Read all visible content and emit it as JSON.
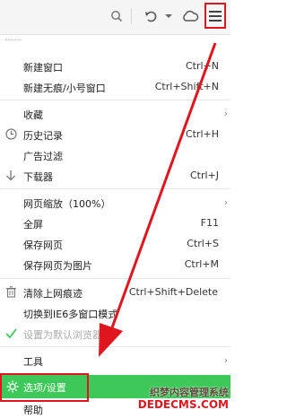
{
  "toolbar": {
    "search_icon": "search-icon",
    "undo_icon": "undo-icon",
    "dropdown_icon": "chevron-down-icon",
    "cloud_icon": "cloud-icon",
    "menu_icon": "hamburger-menu-icon"
  },
  "menu": {
    "new_window": {
      "label": "新建窗口",
      "shortcut": "Ctrl+N"
    },
    "new_private_window": {
      "label": "新建无痕/小号窗口",
      "shortcut": "Ctrl+Shift+N"
    },
    "favorites": {
      "label": "收藏"
    },
    "history": {
      "label": "历史记录",
      "shortcut": "Ctrl+H"
    },
    "ad_filter": {
      "label": "广告过滤"
    },
    "downloader": {
      "label": "下载器",
      "shortcut": "Ctrl+J"
    },
    "zoom": {
      "label": "网页缩放（100%）"
    },
    "fullscreen": {
      "label": "全屏",
      "shortcut": "F11"
    },
    "save_page": {
      "label": "保存网页",
      "shortcut": "Ctrl+S"
    },
    "save_as_image": {
      "label": "保存网页为图片",
      "shortcut": "Ctrl+M"
    },
    "clear_traces": {
      "label": "清除上网痕迹",
      "shortcut": "Ctrl+Shift+Delete"
    },
    "ie6_mode": {
      "label": "切换到IE6多窗口模式"
    },
    "set_default": {
      "label": "设置为默认浏览器"
    },
    "tools": {
      "label": "工具"
    },
    "options": {
      "label": "选项/设置"
    },
    "help": {
      "label": "帮助"
    }
  },
  "colors": {
    "highlight": "#3fc85a",
    "annotation": "#e0161e"
  },
  "watermark": {
    "line1": "织梦内容管理系统",
    "line2": "DEDECMS.COM"
  }
}
